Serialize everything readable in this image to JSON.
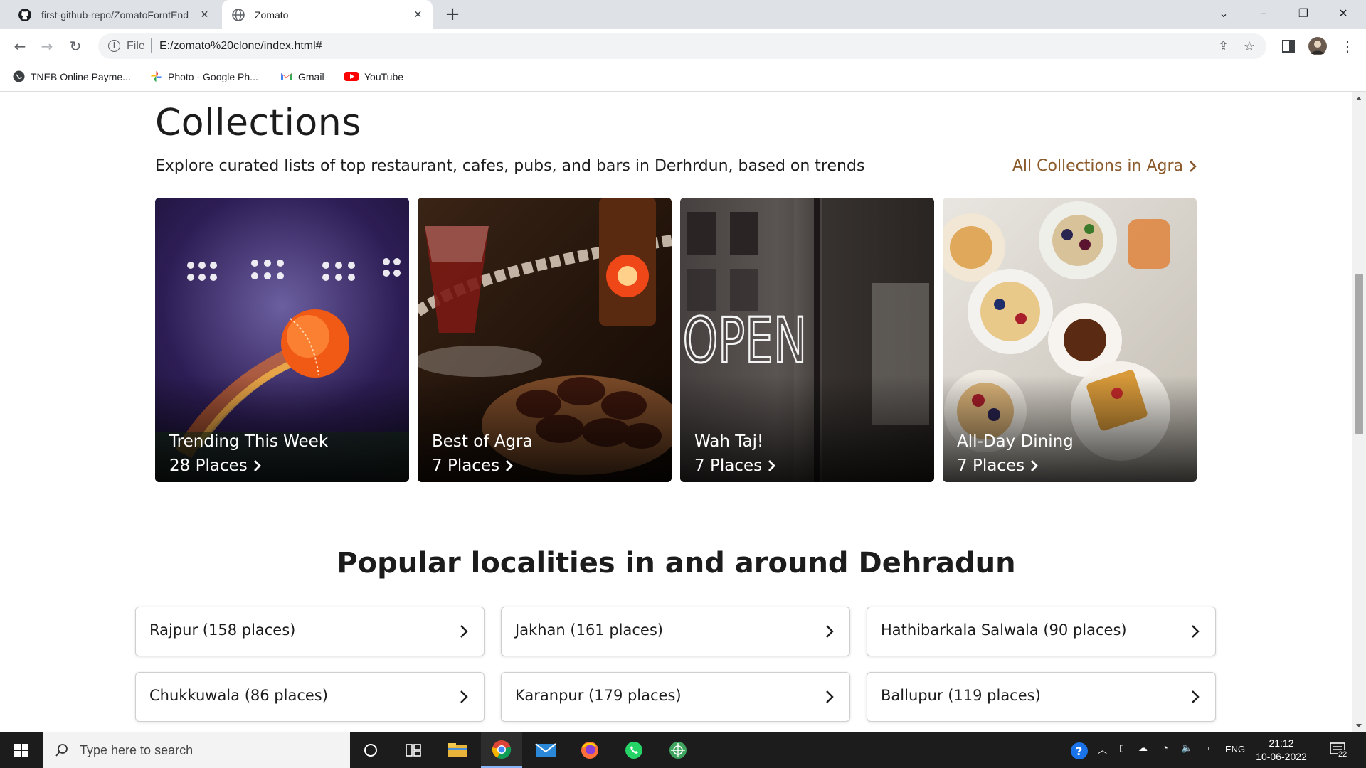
{
  "browser": {
    "tabs": [
      {
        "title": "first-github-repo/ZomatoForntEnd",
        "favicon": "github-icon"
      },
      {
        "title": "Zomato",
        "favicon": "globe-icon"
      }
    ],
    "address": {
      "scheme": "File",
      "url": "E:/zomato%20clone/index.html#"
    },
    "bookmarks": [
      {
        "label": "TNEB Online Payme...",
        "icon": "globe-icon"
      },
      {
        "label": "Photo - Google Ph...",
        "icon": "google-photos-icon"
      },
      {
        "label": "Gmail",
        "icon": "gmail-icon"
      },
      {
        "label": "YouTube",
        "icon": "youtube-icon"
      }
    ]
  },
  "collections": {
    "title": "Collections",
    "subtitle": "Explore curated lists of top restaurant, cafes, pubs, and bars in Derhrdun, based on trends",
    "all_link": "All Collections in Agra",
    "cards": [
      {
        "title": "Trending This Week",
        "count": "28 Places"
      },
      {
        "title": "Best of Agra",
        "count": "7 Places"
      },
      {
        "title": "Wah Taj!",
        "count": "7 Places"
      },
      {
        "title": "All-Day Dining",
        "count": "7 Places"
      }
    ]
  },
  "popular": {
    "title_prefix": "Popular localities in and around",
    "title_city": "Dehradun",
    "localities": [
      "Rajpur (158 places)",
      "Jakhan (161 places)",
      "Hathibarkala Salwala (90 places)",
      "Chukkuwala (86 places)",
      "Karanpur (179 places)",
      "Ballupur (119 places)"
    ]
  },
  "taskbar": {
    "search_placeholder": "Type here to search",
    "language": "ENG",
    "time": "21:12",
    "date": "10-06-2022",
    "notification_count": "22"
  }
}
